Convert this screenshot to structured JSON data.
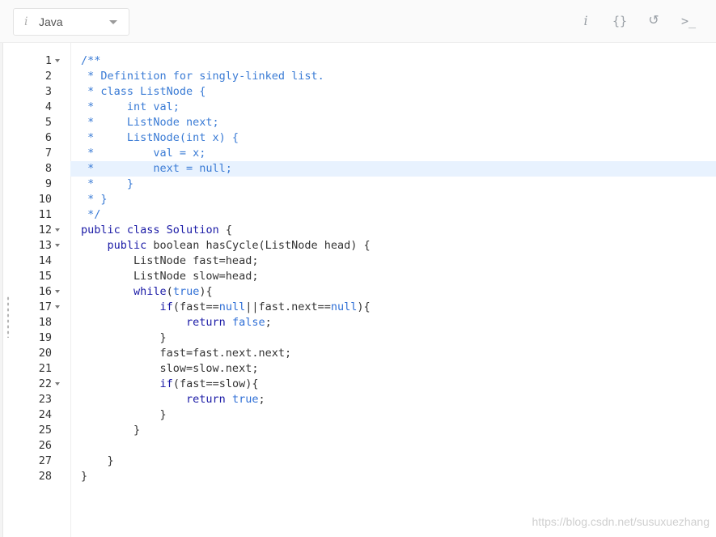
{
  "toolbar": {
    "language": "Java",
    "info_glyph": "i",
    "tools": [
      {
        "name": "info-icon",
        "glyph": "i"
      },
      {
        "name": "format-icon",
        "glyph": "{}"
      },
      {
        "name": "reset-icon",
        "glyph": "↺"
      },
      {
        "name": "console-icon",
        "glyph": ">_"
      }
    ]
  },
  "editor": {
    "active_line": 8,
    "lines": [
      {
        "n": "1",
        "fold": true,
        "code": [
          [
            "comment",
            "/**"
          ]
        ]
      },
      {
        "n": "2",
        "fold": false,
        "code": [
          [
            "comment",
            " * Definition for singly-linked list."
          ]
        ]
      },
      {
        "n": "3",
        "fold": false,
        "code": [
          [
            "comment",
            " * class ListNode {"
          ]
        ]
      },
      {
        "n": "4",
        "fold": false,
        "code": [
          [
            "comment",
            " *     int val;"
          ]
        ]
      },
      {
        "n": "5",
        "fold": false,
        "code": [
          [
            "comment",
            " *     ListNode next;"
          ]
        ]
      },
      {
        "n": "6",
        "fold": false,
        "code": [
          [
            "comment",
            " *     ListNode(int x) {"
          ]
        ]
      },
      {
        "n": "7",
        "fold": false,
        "code": [
          [
            "comment",
            " *         val = x;"
          ]
        ]
      },
      {
        "n": "8",
        "fold": false,
        "code": [
          [
            "comment",
            " *         next = null;"
          ]
        ]
      },
      {
        "n": "9",
        "fold": false,
        "code": [
          [
            "comment",
            " *     }"
          ]
        ]
      },
      {
        "n": "10",
        "fold": false,
        "code": [
          [
            "comment",
            " * }"
          ]
        ]
      },
      {
        "n": "11",
        "fold": false,
        "code": [
          [
            "comment",
            " */"
          ]
        ]
      },
      {
        "n": "12",
        "fold": true,
        "code": [
          [
            "kw",
            "public class "
          ],
          [
            "kw",
            "Solution"
          ],
          [
            "plain",
            " {"
          ]
        ]
      },
      {
        "n": "13",
        "fold": true,
        "code": [
          [
            "plain",
            "    "
          ],
          [
            "kw",
            "public "
          ],
          [
            "plain",
            "boolean hasCycle(ListNode head) {"
          ]
        ]
      },
      {
        "n": "14",
        "fold": false,
        "code": [
          [
            "plain",
            "        ListNode fast=head;"
          ]
        ]
      },
      {
        "n": "15",
        "fold": false,
        "code": [
          [
            "plain",
            "        ListNode slow=head;"
          ]
        ]
      },
      {
        "n": "16",
        "fold": true,
        "code": [
          [
            "plain",
            "        "
          ],
          [
            "kw",
            "while"
          ],
          [
            "plain",
            "("
          ],
          [
            "lit",
            "true"
          ],
          [
            "plain",
            "){"
          ]
        ]
      },
      {
        "n": "17",
        "fold": true,
        "code": [
          [
            "plain",
            "            "
          ],
          [
            "kw",
            "if"
          ],
          [
            "plain",
            "(fast=="
          ],
          [
            "lit",
            "null"
          ],
          [
            "plain",
            "||fast.next=="
          ],
          [
            "lit",
            "null"
          ],
          [
            "plain",
            "){"
          ]
        ]
      },
      {
        "n": "18",
        "fold": false,
        "code": [
          [
            "plain",
            "                "
          ],
          [
            "kw",
            "return "
          ],
          [
            "lit",
            "false"
          ],
          [
            "plain",
            ";"
          ]
        ]
      },
      {
        "n": "19",
        "fold": false,
        "code": [
          [
            "plain",
            "            }"
          ]
        ]
      },
      {
        "n": "20",
        "fold": false,
        "code": [
          [
            "plain",
            "            fast=fast.next.next;"
          ]
        ]
      },
      {
        "n": "21",
        "fold": false,
        "code": [
          [
            "plain",
            "            slow=slow.next;"
          ]
        ]
      },
      {
        "n": "22",
        "fold": true,
        "code": [
          [
            "plain",
            "            "
          ],
          [
            "kw",
            "if"
          ],
          [
            "plain",
            "(fast==slow){"
          ]
        ]
      },
      {
        "n": "23",
        "fold": false,
        "code": [
          [
            "plain",
            "                "
          ],
          [
            "kw",
            "return "
          ],
          [
            "lit",
            "true"
          ],
          [
            "plain",
            ";"
          ]
        ]
      },
      {
        "n": "24",
        "fold": false,
        "code": [
          [
            "plain",
            "            }"
          ]
        ]
      },
      {
        "n": "25",
        "fold": false,
        "code": [
          [
            "plain",
            "        }"
          ]
        ]
      },
      {
        "n": "26",
        "fold": false,
        "code": [
          [
            "plain",
            ""
          ]
        ]
      },
      {
        "n": "27",
        "fold": false,
        "code": [
          [
            "plain",
            "    }"
          ]
        ]
      },
      {
        "n": "28",
        "fold": false,
        "code": [
          [
            "plain",
            "}"
          ]
        ]
      }
    ]
  },
  "watermark": "https://blog.csdn.net/susuxuezhang",
  "colors": {
    "comment": "#3a7bd5",
    "keyword": "#1a1aa6",
    "literal": "#2f6fd6",
    "active_line_bg": "#e8f2fe"
  }
}
